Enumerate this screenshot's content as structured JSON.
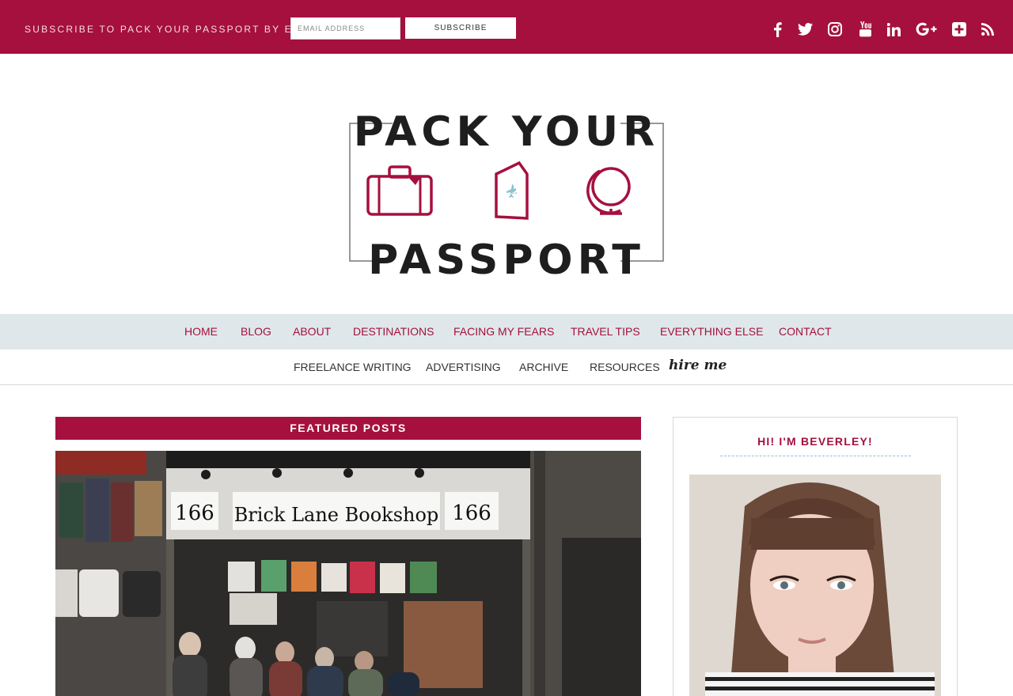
{
  "topbar": {
    "subscribe_text": "SUBSCRIBE TO PACK YOUR PASSPORT BY EMAIL!",
    "email_placeholder": "EMAIL ADDRESS",
    "subscribe_button": "SUBSCRIBE",
    "social_icons": [
      "facebook-icon",
      "twitter-icon",
      "instagram-icon",
      "youtube-icon",
      "linkedin-icon",
      "google-plus-icon",
      "bloglovin-icon",
      "rss-icon"
    ]
  },
  "logo": {
    "line1": "PACK YOUR",
    "line2": "PASSPORT"
  },
  "nav": {
    "row1": [
      "HOME",
      "BLOG",
      "ABOUT",
      "DESTINATIONS",
      "FACING MY FEARS",
      "TRAVEL TIPS",
      "EVERYTHING ELSE",
      "CONTACT"
    ],
    "row2": [
      "FREELANCE WRITING",
      "ADVERTISING",
      "ARCHIVE",
      "RESOURCES"
    ],
    "hire_me": "hire me"
  },
  "featured": {
    "heading": "FEATURED POSTS",
    "sign_number": "166",
    "sign_shop": "Brick Lane Bookshop"
  },
  "sidebar": {
    "title": "HI! I'M BEVERLEY!"
  },
  "colors": {
    "brand": "#a5103e",
    "nav_bg": "#dfe7ea",
    "accent_teal": "#8cc3cf"
  }
}
